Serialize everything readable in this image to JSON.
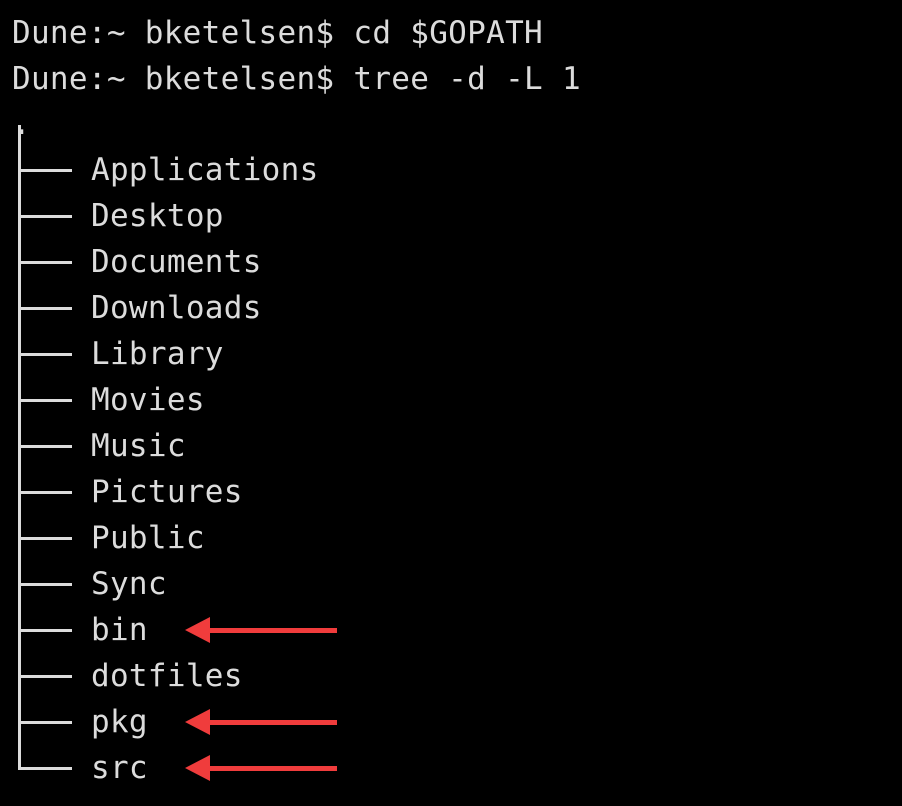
{
  "terminal": {
    "prompt": "Dune:~ bketelsen$",
    "commands": [
      "cd $GOPATH",
      "tree -d -L 1"
    ],
    "root": ".",
    "entries": [
      {
        "name": "Applications",
        "highlighted": false
      },
      {
        "name": "Desktop",
        "highlighted": false
      },
      {
        "name": "Documents",
        "highlighted": false
      },
      {
        "name": "Downloads",
        "highlighted": false
      },
      {
        "name": "Library",
        "highlighted": false
      },
      {
        "name": "Movies",
        "highlighted": false
      },
      {
        "name": "Music",
        "highlighted": false
      },
      {
        "name": "Pictures",
        "highlighted": false
      },
      {
        "name": "Public",
        "highlighted": false
      },
      {
        "name": "Sync",
        "highlighted": false
      },
      {
        "name": "bin",
        "highlighted": true
      },
      {
        "name": "dotfiles",
        "highlighted": false
      },
      {
        "name": "pkg",
        "highlighted": true
      },
      {
        "name": "src",
        "highlighted": true
      }
    ]
  },
  "colors": {
    "background": "#000000",
    "text": "#dcdcdc",
    "arrow": "#f03c3c"
  }
}
